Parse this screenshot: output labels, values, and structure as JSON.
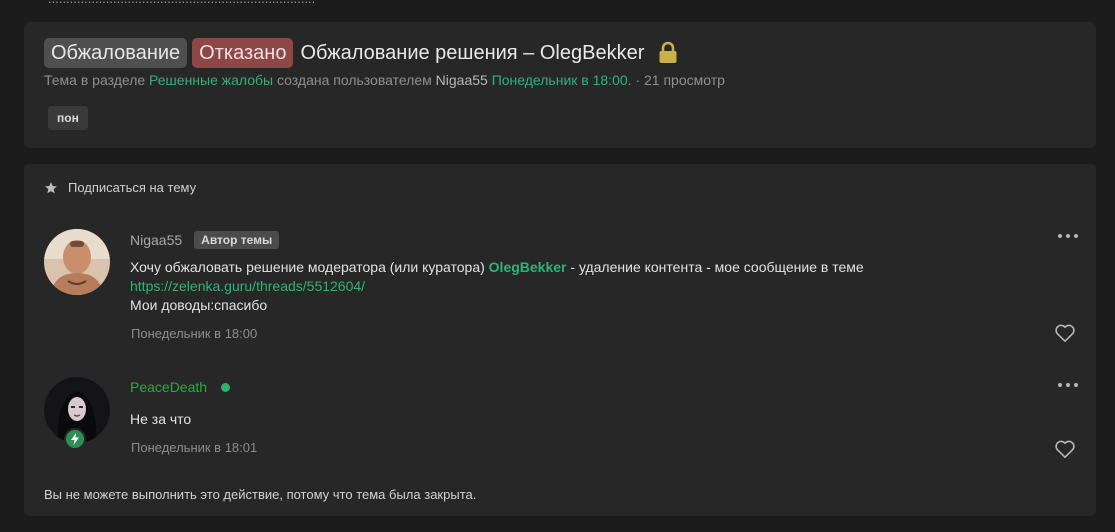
{
  "thread": {
    "prefix_appeal": "Обжалование",
    "prefix_status": "Отказано",
    "title": "Обжалование решения – OlegBekker",
    "meta_prefix": "Тема в разделе",
    "section": "Решенные жалобы",
    "created_by": "создана пользователем",
    "author": "Nigaa55",
    "created_at": "Понедельник в 18:00.",
    "views": "· 21 просмотр",
    "tag": "пон"
  },
  "subscribe_label": "Подписаться на тему",
  "posts": [
    {
      "username": "Nigaa55",
      "author_badge": "Автор темы",
      "text_before": "Хочу обжаловать решение модератора (или куратора)",
      "mention": "OlegBekker",
      "text_after": "- удаление контента - мое сообщение в теме",
      "link": "https://zelenka.guru/threads/5512604/",
      "line3": "Мои доводы:спасибо",
      "date": "Понедельник в 18:00"
    },
    {
      "username": "PeaceDeath",
      "text": "Не за что",
      "date": "Понедельник в 18:01"
    }
  ],
  "closed_notice": "Вы не можете выполнить это действие, потому что тема была закрыта.",
  "colors": {
    "accent_green": "#2eb378",
    "prefix_denied": "#8d4747",
    "prefix_appeal": "#4f4f4f",
    "card_bg": "#272727",
    "page_bg": "#1c1c1c"
  },
  "icons": {
    "lock": "lock-icon",
    "star": "star-icon",
    "more": "more-dots-icon",
    "like": "heart-icon",
    "bolt": "bolt-icon"
  }
}
